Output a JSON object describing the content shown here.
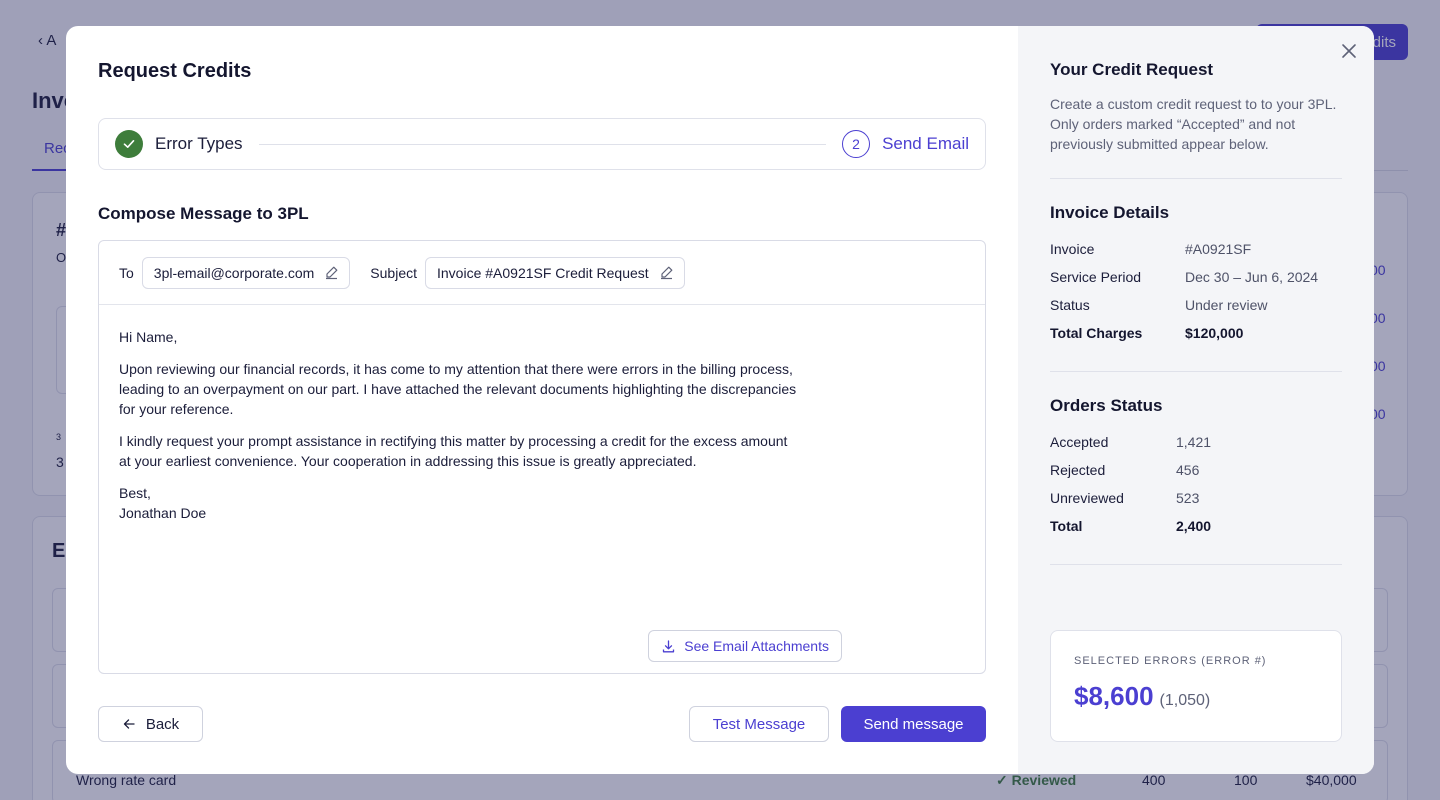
{
  "modal": {
    "title": "Request Credits",
    "stepper": {
      "step1_label": "Error Types",
      "step2_number": "2",
      "step2_label": "Send Email"
    },
    "compose": {
      "section_title": "Compose Message to 3PL",
      "to_label": "To",
      "to_value": "3pl-email@corporate.com",
      "subject_label": "Subject",
      "subject_value": "Invoice #A0921SF Credit Request",
      "body": {
        "greeting": "Hi Name,",
        "paragraph1": "Upon reviewing our financial records, it has come to my attention that there were errors in the billing process, leading to an overpayment on our part. I have attached the relevant documents highlighting the discrepancies for your reference.",
        "paragraph2": "I kindly request your prompt assistance in rectifying this matter by processing a credit for the excess amount at your earliest convenience. Your cooperation in addressing this issue is greatly appreciated.",
        "signoff": "Best,",
        "signature": "Jonathan Doe"
      },
      "attachments_button": "See Email Attachments"
    },
    "footer": {
      "back_label": "Back",
      "test_label": "Test Message",
      "send_label": "Send message"
    }
  },
  "panel": {
    "title": "Your Credit Request",
    "description": "Create a custom credit request to to your 3PL. Only orders marked “Accepted” and not previously submitted appear below.",
    "invoice_details": {
      "heading": "Invoice Details",
      "rows": [
        {
          "label": "Invoice",
          "value": "#A0921SF"
        },
        {
          "label": "Service Period",
          "value": "Dec 30 – Jun 6, 2024"
        },
        {
          "label": "Status",
          "value": "Under review"
        },
        {
          "label": "Total Charges",
          "value": "$120,000"
        }
      ]
    },
    "orders_status": {
      "heading": "Orders Status",
      "rows": [
        {
          "label": "Accepted",
          "value": "1,421"
        },
        {
          "label": "Rejected",
          "value": "456"
        },
        {
          "label": "Unreviewed",
          "value": "523"
        },
        {
          "label": "Total",
          "value": "2,400"
        }
      ]
    },
    "selected_errors": {
      "label": "SELECTED ERRORS (ERROR #)",
      "amount": "$8,600",
      "count": "(1,050)"
    }
  },
  "background": {
    "back_link": "A",
    "page_title": "Invo",
    "tab": "Rec",
    "top_button": "dits",
    "card_title": "#",
    "card_sub": "O",
    "small_label": "3",
    "small_value": "3",
    "values": [
      "00",
      "00",
      "00",
      "00"
    ],
    "errors_title": "E",
    "row_label": "Wrong rate card",
    "row_status": "Reviewed",
    "row_col1": "400",
    "row_col2": "100",
    "row_col3": "$40,000"
  },
  "colors": {
    "accent": "#4b3fd1",
    "success": "#3e7d3b",
    "overlay": "#26285c"
  }
}
